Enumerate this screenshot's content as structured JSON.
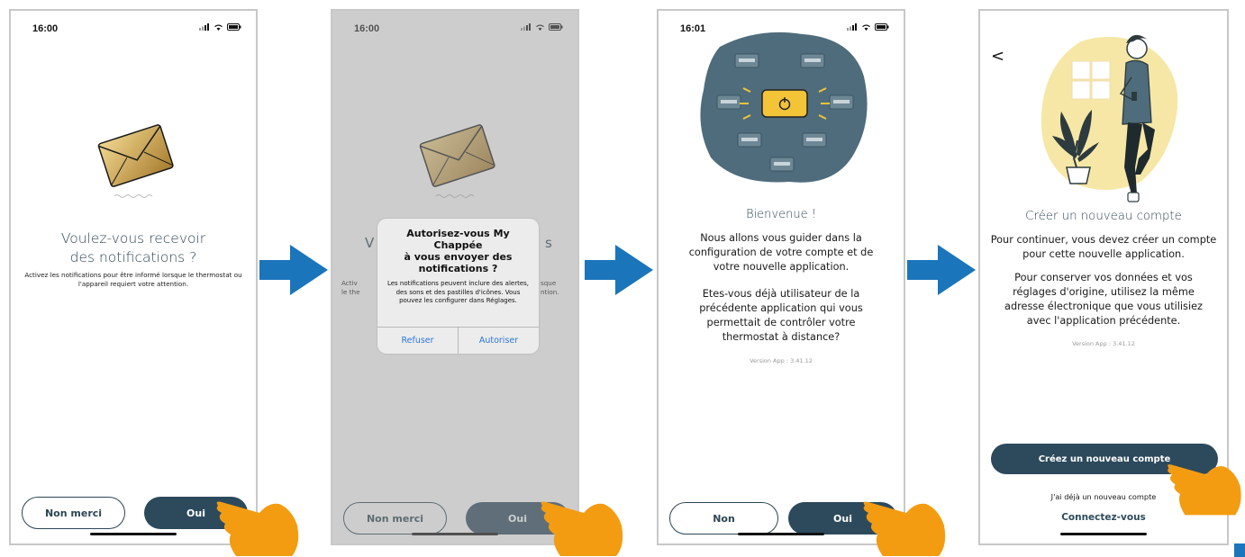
{
  "screen1": {
    "time": "16:00",
    "title": "Voulez-vous recevoir des notifications ?",
    "subtitle": "Activez les notifications pour être informé lorsque le thermostat ou l'appareil requiert votre attention.",
    "btn_secondary": "Non merci",
    "btn_primary": "Oui"
  },
  "screen2": {
    "time": "16:00",
    "bg_title_fragment_left": "V",
    "bg_title_fragment_right": "s",
    "bg_sub_left_1": "Activ",
    "bg_sub_left_2": "le the",
    "bg_sub_right_1": "sque",
    "bg_sub_right_2": "ntion.",
    "dialog_title_line1": "Autorisez-vous  My Chappée",
    "dialog_title_line2": "à vous envoyer des",
    "dialog_title_line3": "notifications ?",
    "dialog_message": "Les notifications peuvent inclure des alertes, des sons et des pastilles d'icônes. Vous pouvez les configurer dans Réglages.",
    "dialog_refuse": "Refuser",
    "dialog_allow": "Autoriser",
    "btn_secondary": "Non merci",
    "btn_primary": "Oui"
  },
  "screen3": {
    "time": "16:01",
    "title": "Bienvenue !",
    "paragraph1": "Nous allons vous guider dans la configuration de votre compte et de votre nouvelle application.",
    "paragraph2": "Etes-vous déjà utilisateur de la précédente application qui vous permettait de contrôler votre thermostat à distance?",
    "version": "Version App : 3.41.12",
    "btn_secondary": "Non",
    "btn_primary": "Oui"
  },
  "screen4": {
    "back": "<",
    "title": "Créer un nouveau compte",
    "paragraph1": "Pour continuer, vous devez créer un compte pour cette nouvelle application.",
    "paragraph2": "Pour conserver vos données et vos réglages d'origine, utilisez la même adresse électronique que vous utilisiez avec l'application précédente.",
    "version": "Version App : 3.41.12",
    "btn_primary": "Créez un nouveau compte",
    "already_text": "J'ai déjà un nouveau compte",
    "connect_link": "Connectez-vous"
  },
  "colors": {
    "primary": "#2d4a5c",
    "title": "#2d4654",
    "arrow": "#1b75bb",
    "hand": "#f39c12",
    "envelope": "#d6ad5c",
    "illustration_bg": "#4f6c7c",
    "accent_yellow": "#f7e7a6",
    "link_blue": "#2b76d8"
  },
  "icons": [
    "envelope-icon",
    "arrow-right-icon",
    "tap-hand-icon",
    "signal-icon",
    "wifi-icon",
    "battery-icon",
    "back-chevron-icon",
    "thermostat-illustration",
    "person-illustration"
  ]
}
